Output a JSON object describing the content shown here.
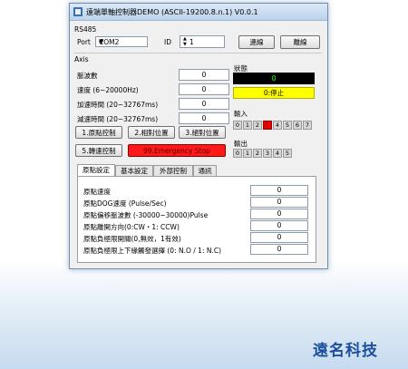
{
  "window": {
    "title": "遠端單軸控制器DEMO (ASCII-19200.8.n.1) V0.0.1"
  },
  "rs485": {
    "group_label": "RS485",
    "port_label": "Port",
    "port_value": "COM2",
    "id_label": "ID",
    "id_value": "1",
    "connect_label": "連線",
    "disconnect_label": "離線"
  },
  "axis": {
    "group_label": "Axis",
    "params": [
      {
        "label": "脈波數",
        "value": "0"
      },
      {
        "label": "速度 (6~20000Hz)",
        "value": "0"
      },
      {
        "label": "加速時間 (20~32767ms)",
        "value": "0"
      },
      {
        "label": "減速時間 (20~32767ms)",
        "value": "0"
      }
    ],
    "buttons": {
      "home": "1.原點控制",
      "relative": "2.相對位置",
      "absolute": "3.絕對位置",
      "speed": "5.轉速控制",
      "estop": "99.Emergency Stop"
    }
  },
  "status": {
    "label": "狀態",
    "value": "0",
    "text": "0:停止"
  },
  "inputs": {
    "label": "輸入",
    "bits": [
      "0",
      "1",
      "2",
      "3",
      "4",
      "5",
      "6",
      "7"
    ],
    "active": [
      3
    ]
  },
  "outputs": {
    "label": "輸出",
    "bits": [
      "0",
      "1",
      "2",
      "3",
      "4",
      "5"
    ]
  },
  "tabs": [
    "原點設定",
    "基本設定",
    "外部控制",
    "通訊"
  ],
  "home_settings": [
    {
      "label": "原點速度",
      "value": "0"
    },
    {
      "label": "原點DOG速度 (Pulse/Sec)",
      "value": "0"
    },
    {
      "label": "原點偏移脈波數 (-30000~30000)Pulse",
      "value": "0"
    },
    {
      "label": "原點離開方向(0:CW・1: CCW)",
      "value": "0"
    },
    {
      "label": "原點負極限開關(0,無效，1有效)",
      "value": "0"
    },
    {
      "label": "原點負極限上下緣觸發選擇 (0: N.O / 1: N.C)",
      "value": "0"
    }
  ],
  "brand": "遠名科技",
  "colors": {
    "status_bg": "#000000",
    "status_fg": "#00ff00",
    "status_text_bg": "#ffff00",
    "estop_bg": "#ff0000",
    "input_active": "#e00000"
  }
}
